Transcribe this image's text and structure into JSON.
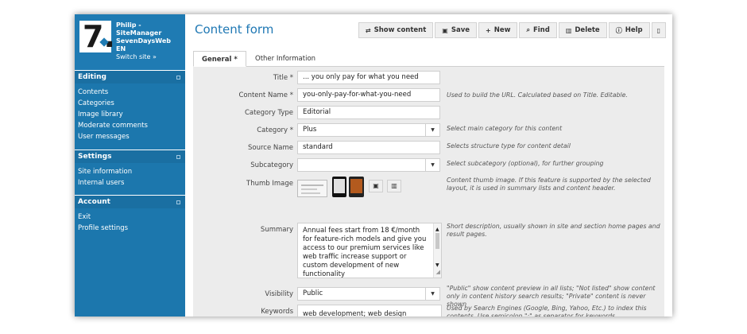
{
  "brand": {
    "line1": "Philip -",
    "line2": "SiteManager",
    "line3": "SevenDaysWeb",
    "line4": "EN",
    "switch": "Switch site »",
    "logo_text": "7."
  },
  "sidebar": {
    "sections": [
      {
        "title": "Editing",
        "items": [
          "Contents",
          "Categories",
          "Image library",
          "Moderate comments",
          "User messages"
        ]
      },
      {
        "title": "Settings",
        "items": [
          "Site information",
          "Internal users"
        ]
      },
      {
        "title": "Account",
        "items": [
          "Exit",
          "Profile settings"
        ]
      }
    ]
  },
  "header": {
    "title": "Content form"
  },
  "toolbar": {
    "show_content": "Show content",
    "save": "Save",
    "new": "New",
    "find": "Find",
    "delete": "Delete",
    "help": "Help"
  },
  "tabs": {
    "general": "General *",
    "other": "Other Information"
  },
  "form": {
    "title": {
      "label": "Title *",
      "value": "... you only pay for what you need"
    },
    "content_name": {
      "label": "Content Name *",
      "value": "you-only-pay-for-what-you-need",
      "hint": "Used to build the URL. Calculated based on Title. Editable."
    },
    "category_type": {
      "label": "Category Type",
      "value": "Editorial"
    },
    "category": {
      "label": "Category *",
      "value": "Plus",
      "hint": "Select main category for this content"
    },
    "source_name": {
      "label": "Source Name",
      "value": "standard",
      "hint": "Selects structure type for content detail"
    },
    "subcategory": {
      "label": "Subcategory",
      "value": "",
      "hint": "Select subcategory (optional), for further grouping"
    },
    "thumb_image": {
      "label": "Thumb Image",
      "hint": "Content thumb image. If this feature is supported by the selected layout, it is used in summary lists and content header."
    },
    "summary": {
      "label": "Summary",
      "value": "Annual fees start from 18 €/month for feature-rich models and give you access to our premium services like web traffic increase support or custom development of new functionality",
      "hint": "Short description, usually shown in site and section home pages and result pages."
    },
    "visibility": {
      "label": "Visibility",
      "value": "Public",
      "hint": "\"Public\" show content preview in all lists; \"Not listed\" show content only in content history search results; \"Private\" content is never shown"
    },
    "keywords": {
      "label": "Keywords",
      "value": "web development; web design",
      "hint": "Used by Search Engines (Google, Bing, Yahoo, Etc.) to index this contents. Use semicolon \";\" as separator for keywords"
    }
  }
}
